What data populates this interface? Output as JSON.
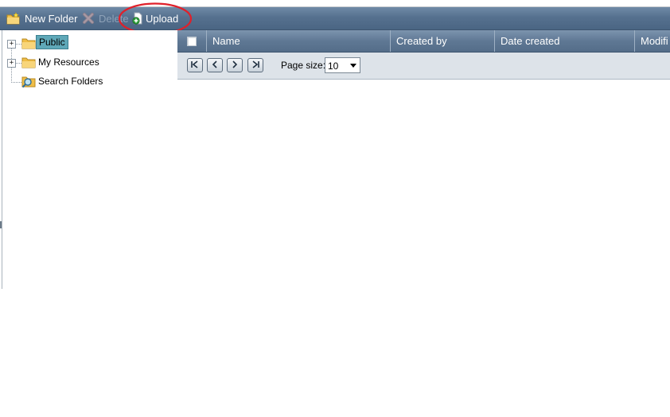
{
  "toolbar": {
    "new_folder_label": "New Folder",
    "delete_label": "Delete",
    "upload_label": "Upload"
  },
  "tree": {
    "items": [
      {
        "label": "Public",
        "icon": "folder-icon",
        "expandable": true,
        "selected": true
      },
      {
        "label": "My Resources",
        "icon": "folder-icon",
        "expandable": true,
        "selected": false
      },
      {
        "label": "Search Folders",
        "icon": "search-folder-icon",
        "expandable": false,
        "selected": false
      }
    ]
  },
  "grid": {
    "columns": [
      "Name",
      "Created by",
      "Date created",
      "Modifi"
    ]
  },
  "pager": {
    "page_size_label": "Page size:",
    "page_size_value": "10",
    "buttons": [
      "first-page",
      "previous-page",
      "next-page",
      "last-page"
    ]
  },
  "colors": {
    "toolbar": "#56718f",
    "header": "#5f7894",
    "pager_bg": "#dde3e9",
    "selection": "#5fa8b8",
    "highlight": "#e0202a"
  }
}
